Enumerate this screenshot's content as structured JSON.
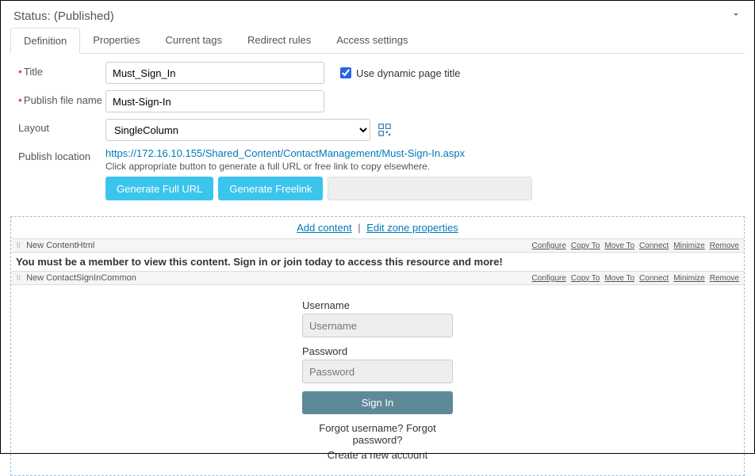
{
  "status": {
    "label": "Status: (Published)"
  },
  "tabs": [
    {
      "label": "Definition",
      "active": true
    },
    {
      "label": "Properties"
    },
    {
      "label": "Current tags"
    },
    {
      "label": "Redirect rules"
    },
    {
      "label": "Access settings"
    }
  ],
  "form": {
    "title_label": "Title",
    "title_value": "Must_Sign_In",
    "dynamic_title_label": "Use dynamic page title",
    "publish_file_label": "Publish file name",
    "publish_file_value": "Must-Sign-In",
    "layout_label": "Layout",
    "layout_value": "SingleColumn",
    "publish_location_label": "Publish location",
    "publish_location_url": "https://172.16.10.155/Shared_Content/ContactManagement/Must-Sign-In.aspx",
    "publish_location_hint": "Click appropriate button to generate a full URL or free link to copy elsewhere.",
    "btn_full_url": "Generate Full URL",
    "btn_freelink": "Generate Freelink"
  },
  "zone": {
    "add_content": "Add content",
    "edit_props": "Edit zone properties",
    "sep": " | "
  },
  "module_actions": [
    "Configure",
    "Copy To",
    "Move To",
    "Connect",
    "Minimize",
    "Remove"
  ],
  "content_html": {
    "title": "New ContentHtml",
    "body": "You must be a member to view this content. Sign in or join today to access this resource and more!"
  },
  "signin_module": {
    "title": "New ContactSignInCommon",
    "username_label": "Username",
    "username_placeholder": "Username",
    "password_label": "Password",
    "password_placeholder": "Password",
    "signin_btn": "Sign In",
    "forgot": "Forgot username? Forgot password?",
    "create": "Create a new account"
  }
}
